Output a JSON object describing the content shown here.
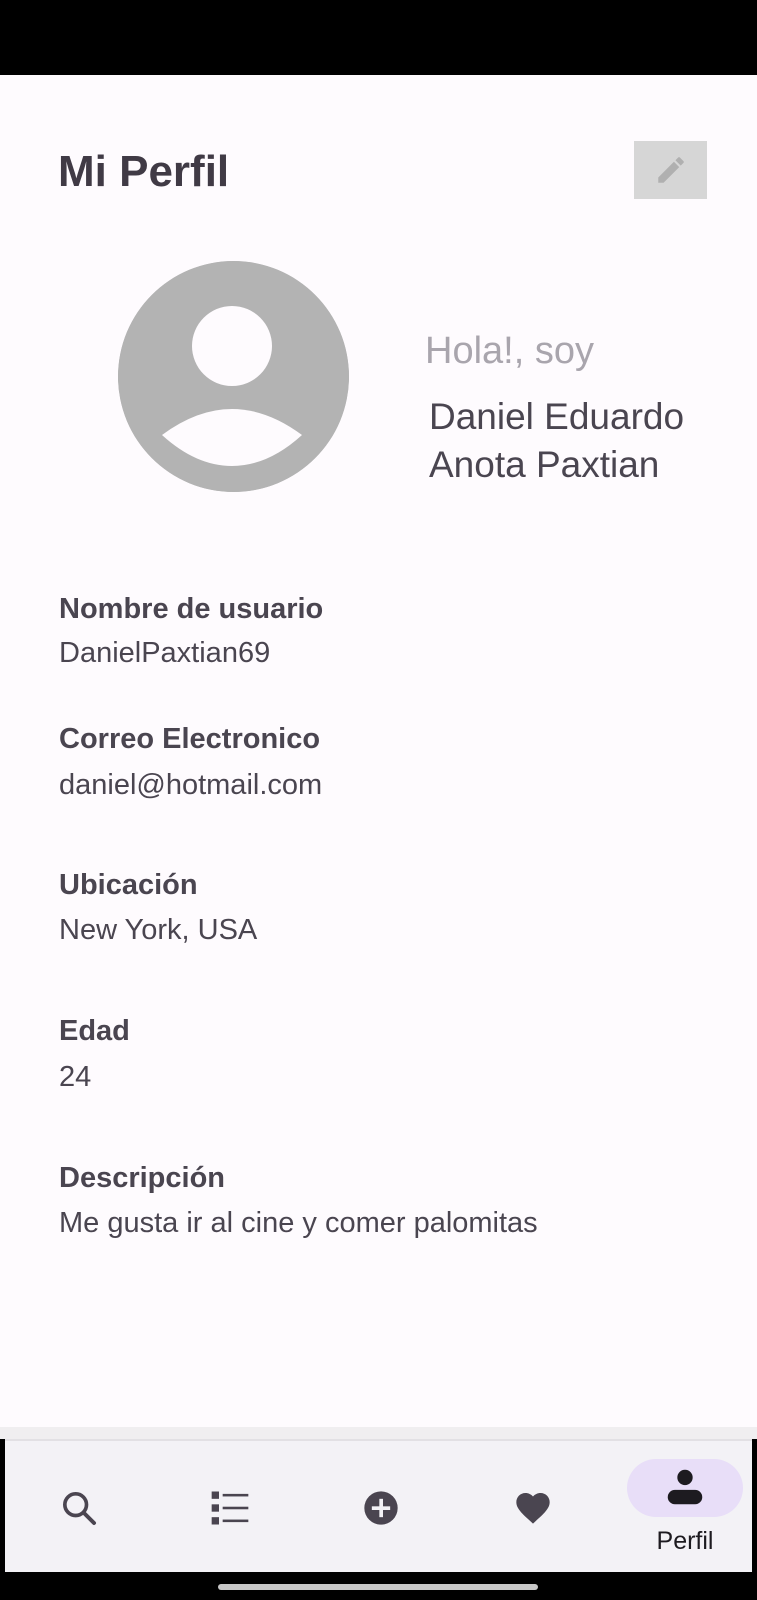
{
  "header": {
    "title": "Mi Perfil",
    "edit_icon": "pencil-icon"
  },
  "profile": {
    "greeting": "Hola!, soy",
    "name_line1": "Daniel Eduardo",
    "name_line2": "Anota Paxtian",
    "avatar_icon": "person-placeholder-icon"
  },
  "fields": {
    "username": {
      "label": "Nombre de usuario",
      "value": "DanielPaxtian69"
    },
    "email": {
      "label": "Correo Electronico",
      "value": "daniel@hotmail.com"
    },
    "location": {
      "label": "Ubicación",
      "value": "New York, USA"
    },
    "age": {
      "label": "Edad",
      "value": "24"
    },
    "description": {
      "label": "Descripción",
      "value": "Me gusta ir al cine y comer palomitas"
    }
  },
  "bottom_nav": {
    "items": [
      {
        "icon": "search-icon"
      },
      {
        "icon": "list-icon"
      },
      {
        "icon": "add-circle-icon"
      },
      {
        "icon": "heart-icon"
      },
      {
        "icon": "person-icon",
        "label": "Perfil",
        "selected": true
      }
    ]
  },
  "colors": {
    "background": "#fefbfe",
    "text": "#4a4550",
    "muted_text": "#a9a5ad",
    "avatar": "#b3b3b3",
    "nav_background": "#f3f2f6",
    "nav_active_pill": "#e8def8"
  }
}
